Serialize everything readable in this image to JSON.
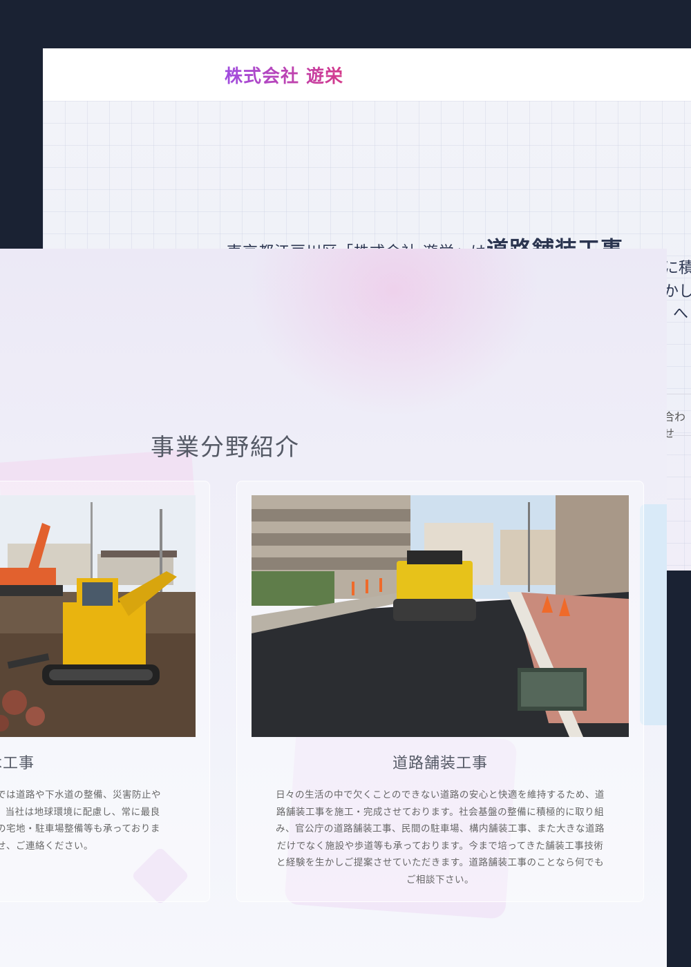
{
  "back_window": {
    "logo": "株式会社 遊栄",
    "headline_pre": "東京都江戸川区「株式会社 遊栄」は",
    "headline_emph": "道路舗装工事",
    "headline_post": "、",
    "frag1": "に積",
    "frag2": "かし",
    "frag3": "へ",
    "contact_frag": "合わせ"
  },
  "main": {
    "section_title": "事業分野紹介",
    "cards": [
      {
        "title": "木工事",
        "photo": "excavator-photo",
        "lines": [
          "社では道路や下水道の整備、災害防止や",
          "す。当社は地球環境に配慮し、常に最良",
          "間の宅地・駐車場整備等も承っておりま",
          "合せ、ご連絡ください。"
        ]
      },
      {
        "title": "道路舗装工事",
        "photo": "road-roller-photo",
        "lines": [
          "日々の生活の中で欠くことのできない道路の安心と快適を維持するため、道",
          "路舗装工事を施工・完成させております。社会基盤の整備に積極的に取り組",
          "み、官公庁の道路舗装工事、民間の駐車場、構内舗装工事、また大きな道路",
          "だけでなく施設や歩道等も承っております。今まで培ってきた舗装工事技術",
          "と経験を生かしご提案させていただきます。道路舗装工事のことなら何でも",
          "ご相談下さい。"
        ]
      }
    ]
  }
}
